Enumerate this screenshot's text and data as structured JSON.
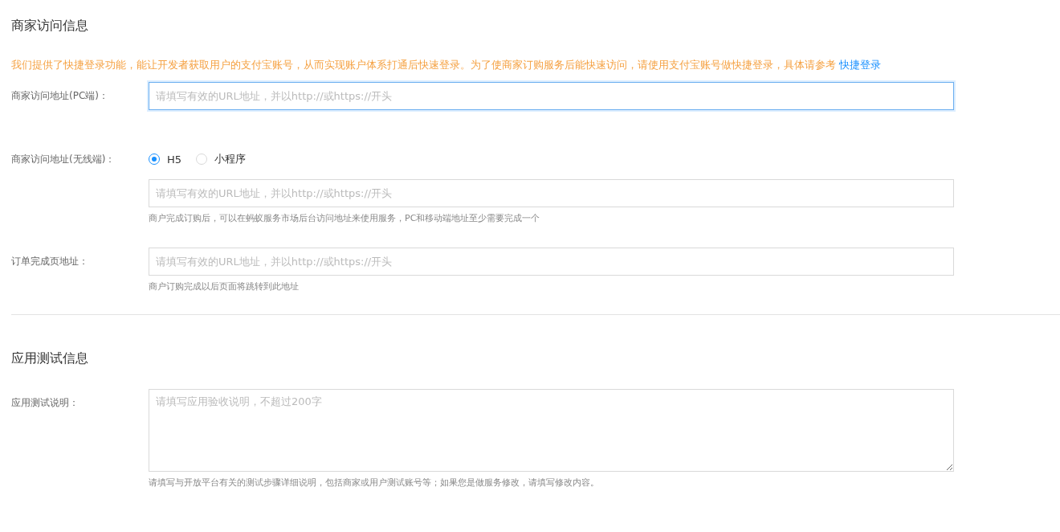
{
  "sections": [
    {
      "title": "商家访问信息",
      "notice": {
        "text": "我们提供了快捷登录功能，能让开发者获取用户的支付宝账号，从而实现账户体系打通后快速登录。为了使商家订购服务后能快速访问，请使用支付宝账号做快捷登录，具体请参考 ",
        "link": "快捷登录"
      },
      "fields": [
        {
          "kind": "input",
          "label": "商家访问地址(PC端)：",
          "placeholder": "请填写有效的URL地址，并以http://或https://开头",
          "focused": true
        },
        {
          "kind": "radio-input",
          "label": "商家访问地址(无线端)：",
          "options": [
            {
              "label": "H5",
              "selected": true
            },
            {
              "label": "小程序",
              "selected": false
            }
          ],
          "placeholder": "请填写有效的URL地址，并以http://或https://开头",
          "focused": false,
          "help": "商户完成订购后，可以在蚂蚁服务市场后台访问地址来使用服务，PC和移动端地址至少需要完成一个"
        },
        {
          "kind": "input",
          "label": "订单完成页地址：",
          "placeholder": "请填写有效的URL地址，并以http://或https://开头",
          "focused": false,
          "help": "商户订购完成以后页面将跳转到此地址"
        }
      ]
    },
    {
      "title": "应用测试信息",
      "fields": [
        {
          "kind": "textarea",
          "label": "应用测试说明：",
          "placeholder": "请填写应用验收说明，不超过200字",
          "focused": false,
          "help": "请填写与开放平台有关的测试步骤详细说明，包括商家或用户测试账号等；如果您是做服务修改，请填写修改内容。"
        }
      ]
    }
  ]
}
